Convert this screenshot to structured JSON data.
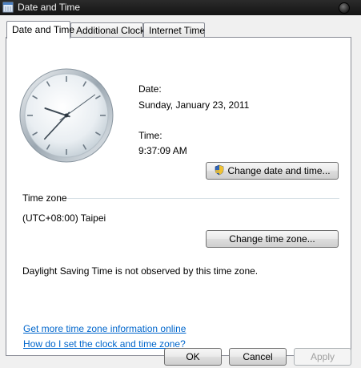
{
  "window": {
    "title": "Date and Time"
  },
  "tabs": [
    {
      "label": "Date and Time",
      "active": true
    },
    {
      "label": "Additional Clocks",
      "active": false
    },
    {
      "label": "Internet Time",
      "active": false
    }
  ],
  "clock": {
    "hours": 9,
    "minutes": 37,
    "seconds": 9
  },
  "date": {
    "label": "Date:",
    "value": "Sunday, January 23, 2011"
  },
  "time": {
    "label": "Time:",
    "value": "9:37:09 AM"
  },
  "change_date_button": "Change date and time...",
  "timezone": {
    "heading": "Time zone",
    "value": "(UTC+08:00) Taipei",
    "change_button": "Change time zone...",
    "dst_note": "Daylight Saving Time is not observed by this time zone."
  },
  "links": {
    "more_info": "Get more time zone information online",
    "how_to": "How do I set the clock and time zone?"
  },
  "buttons": {
    "ok": "OK",
    "cancel": "Cancel",
    "apply": "Apply"
  },
  "colors": {
    "link": "#0066cc",
    "titlebar": "#1f1f1f"
  }
}
